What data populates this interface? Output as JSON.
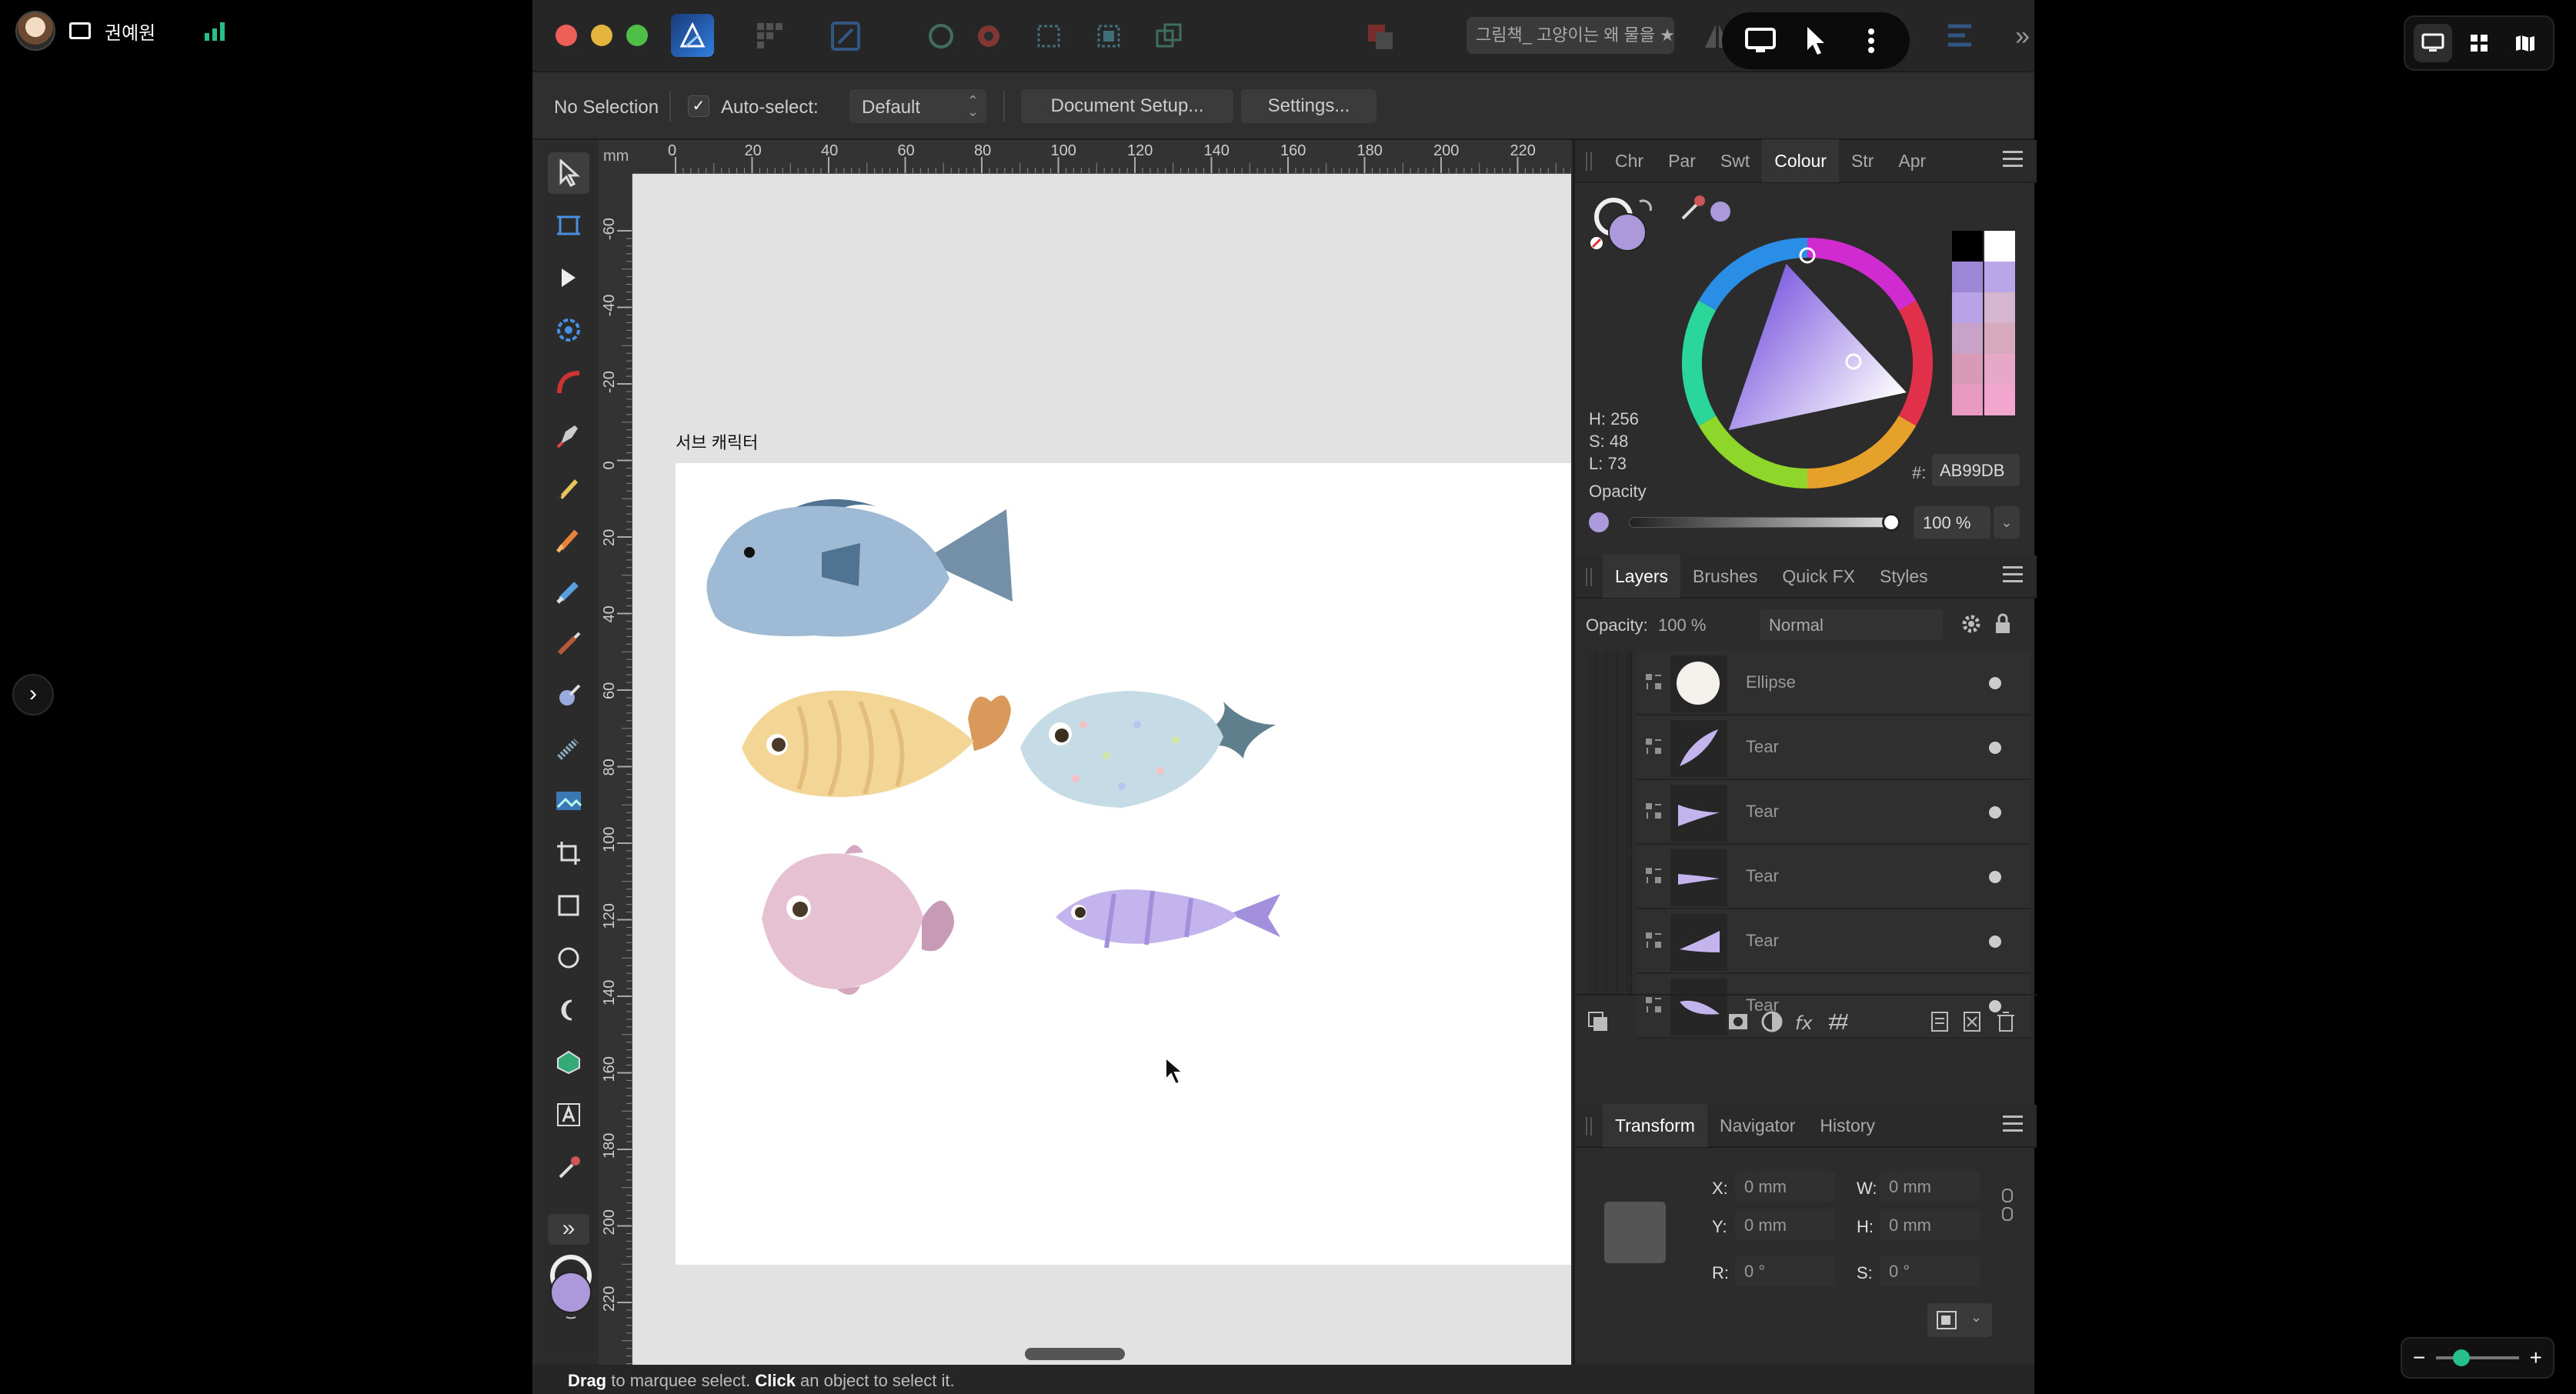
{
  "remote": {
    "username": "권예원",
    "zoom_minus": "−",
    "zoom_plus": "+"
  },
  "window": {
    "document_tab": "그림책_ 고양이는 왜 물을 ★"
  },
  "context_toolbar": {
    "selection_status": "No Selection",
    "autoselect_label": "Auto-select:",
    "autoselect_checked": true,
    "autoselect_mode": "Default",
    "document_setup_label": "Document Setup...",
    "settings_label": "Settings..."
  },
  "ruler": {
    "unit": "mm",
    "h_ticks": [
      "0",
      "20",
      "40",
      "60",
      "80",
      "100",
      "120",
      "140",
      "160",
      "180",
      "200",
      "220"
    ],
    "v_ticks": [
      "-60",
      "-40",
      "-20",
      "0",
      "20",
      "40",
      "60",
      "80",
      "100",
      "120",
      "140",
      "160",
      "180",
      "200",
      "220"
    ]
  },
  "canvas": {
    "artboard_label": "서브 캐릭터"
  },
  "colour_panel": {
    "tabs": [
      "Chr",
      "Par",
      "Swt",
      "Colour",
      "Str",
      "Apr"
    ],
    "active_tab": "Colour",
    "h": "H: 256",
    "s": "S: 48",
    "l": "L: 73",
    "hex_label": "#:",
    "hex": "AB99DB",
    "opacity_label": "Opacity",
    "opacity_value": "100 %",
    "current_color": "#AB99DB",
    "swatches": [
      "#000000",
      "#ffffff",
      "#9b87d6",
      "#b8a6e8",
      "#b9a2e6",
      "#d6b6cf",
      "#c8a2c8",
      "#d7a9bd",
      "#d99ab7",
      "#e6a8c6",
      "#e89ac0",
      "#f3a6cd"
    ]
  },
  "layers_panel": {
    "tabs": [
      "Layers",
      "Brushes",
      "Quick FX",
      "Styles"
    ],
    "active_tab": "Layers",
    "opacity_label": "Opacity:",
    "opacity_value": "100 %",
    "blend_mode": "Normal",
    "layers": [
      {
        "name": "Ellipse",
        "thumb": "ellipse"
      },
      {
        "name": "Tear",
        "thumb": "tear-diag"
      },
      {
        "name": "Tear",
        "thumb": "tear-right"
      },
      {
        "name": "Tear",
        "thumb": "tear-flat"
      },
      {
        "name": "Tear",
        "thumb": "tear-left"
      },
      {
        "name": "Tear",
        "thumb": "tear-left2"
      }
    ]
  },
  "transform_panel": {
    "tabs": [
      "Transform",
      "Navigator",
      "History"
    ],
    "active_tab": "Transform",
    "x_label": "X:",
    "x_value": "0 mm",
    "y_label": "Y:",
    "y_value": "0 mm",
    "w_label": "W:",
    "w_value": "0 mm",
    "h_label": "H:",
    "h_value": "0 mm",
    "r_label": "R:",
    "r_value": "0 °",
    "s_label": "S:",
    "s_value": "0 °"
  },
  "status_bar": {
    "drag_word": "Drag",
    "drag_text": " to marquee select. ",
    "click_word": "Click",
    "click_text": " an object to select it."
  }
}
